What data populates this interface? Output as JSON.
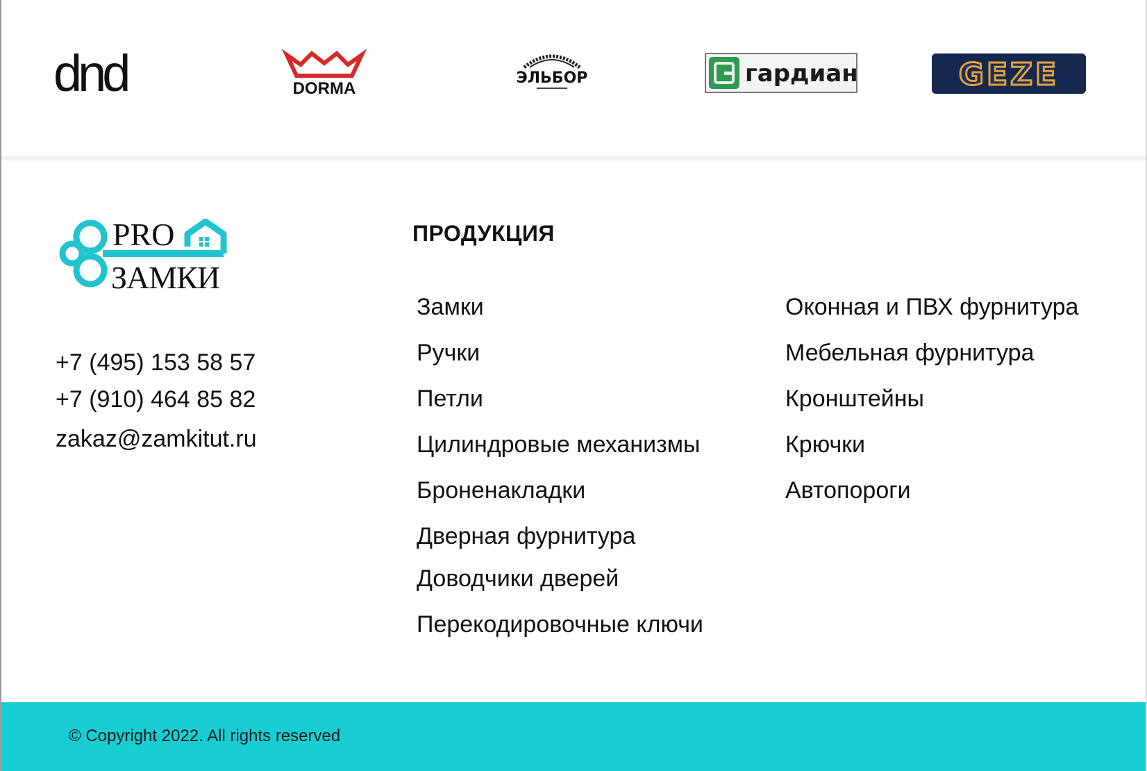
{
  "brands": [
    {
      "name": "dnd-logo",
      "text": "dnd"
    },
    {
      "name": "dorma-logo",
      "text": "DORMA"
    },
    {
      "name": "elbor-logo",
      "text": "ЭЛЬБОР"
    },
    {
      "name": "gardian-logo",
      "text": "гардиан"
    },
    {
      "name": "geze-logo",
      "text": "GEZE"
    }
  ],
  "logo": {
    "line1": "PRO",
    "line2": "ЗАМКИ",
    "accent_color": "#22c3cf"
  },
  "contacts": {
    "phone1": "+7 (495) 153 58 57",
    "phone2": "+7 (910) 464 85 82",
    "email": "zakaz@zamkitut.ru"
  },
  "products": {
    "title": "ПРОДУКЦИЯ",
    "column1": [
      "Замки",
      "Ручки",
      "Петли",
      "Цилиндровые механизмы",
      "Броненакладки",
      "Дверная фурнитура",
      "Доводчики дверей",
      "Перекодировочные ключи"
    ],
    "column2": [
      "Оконная и ПВХ фурнитура",
      "Мебельная фурнитура",
      "Кронштейны",
      "Крючки",
      "Автопороги"
    ]
  },
  "footer": {
    "copyright": "© Copyright 2022. All rights reserved",
    "bar_color": "#17cdd3"
  }
}
